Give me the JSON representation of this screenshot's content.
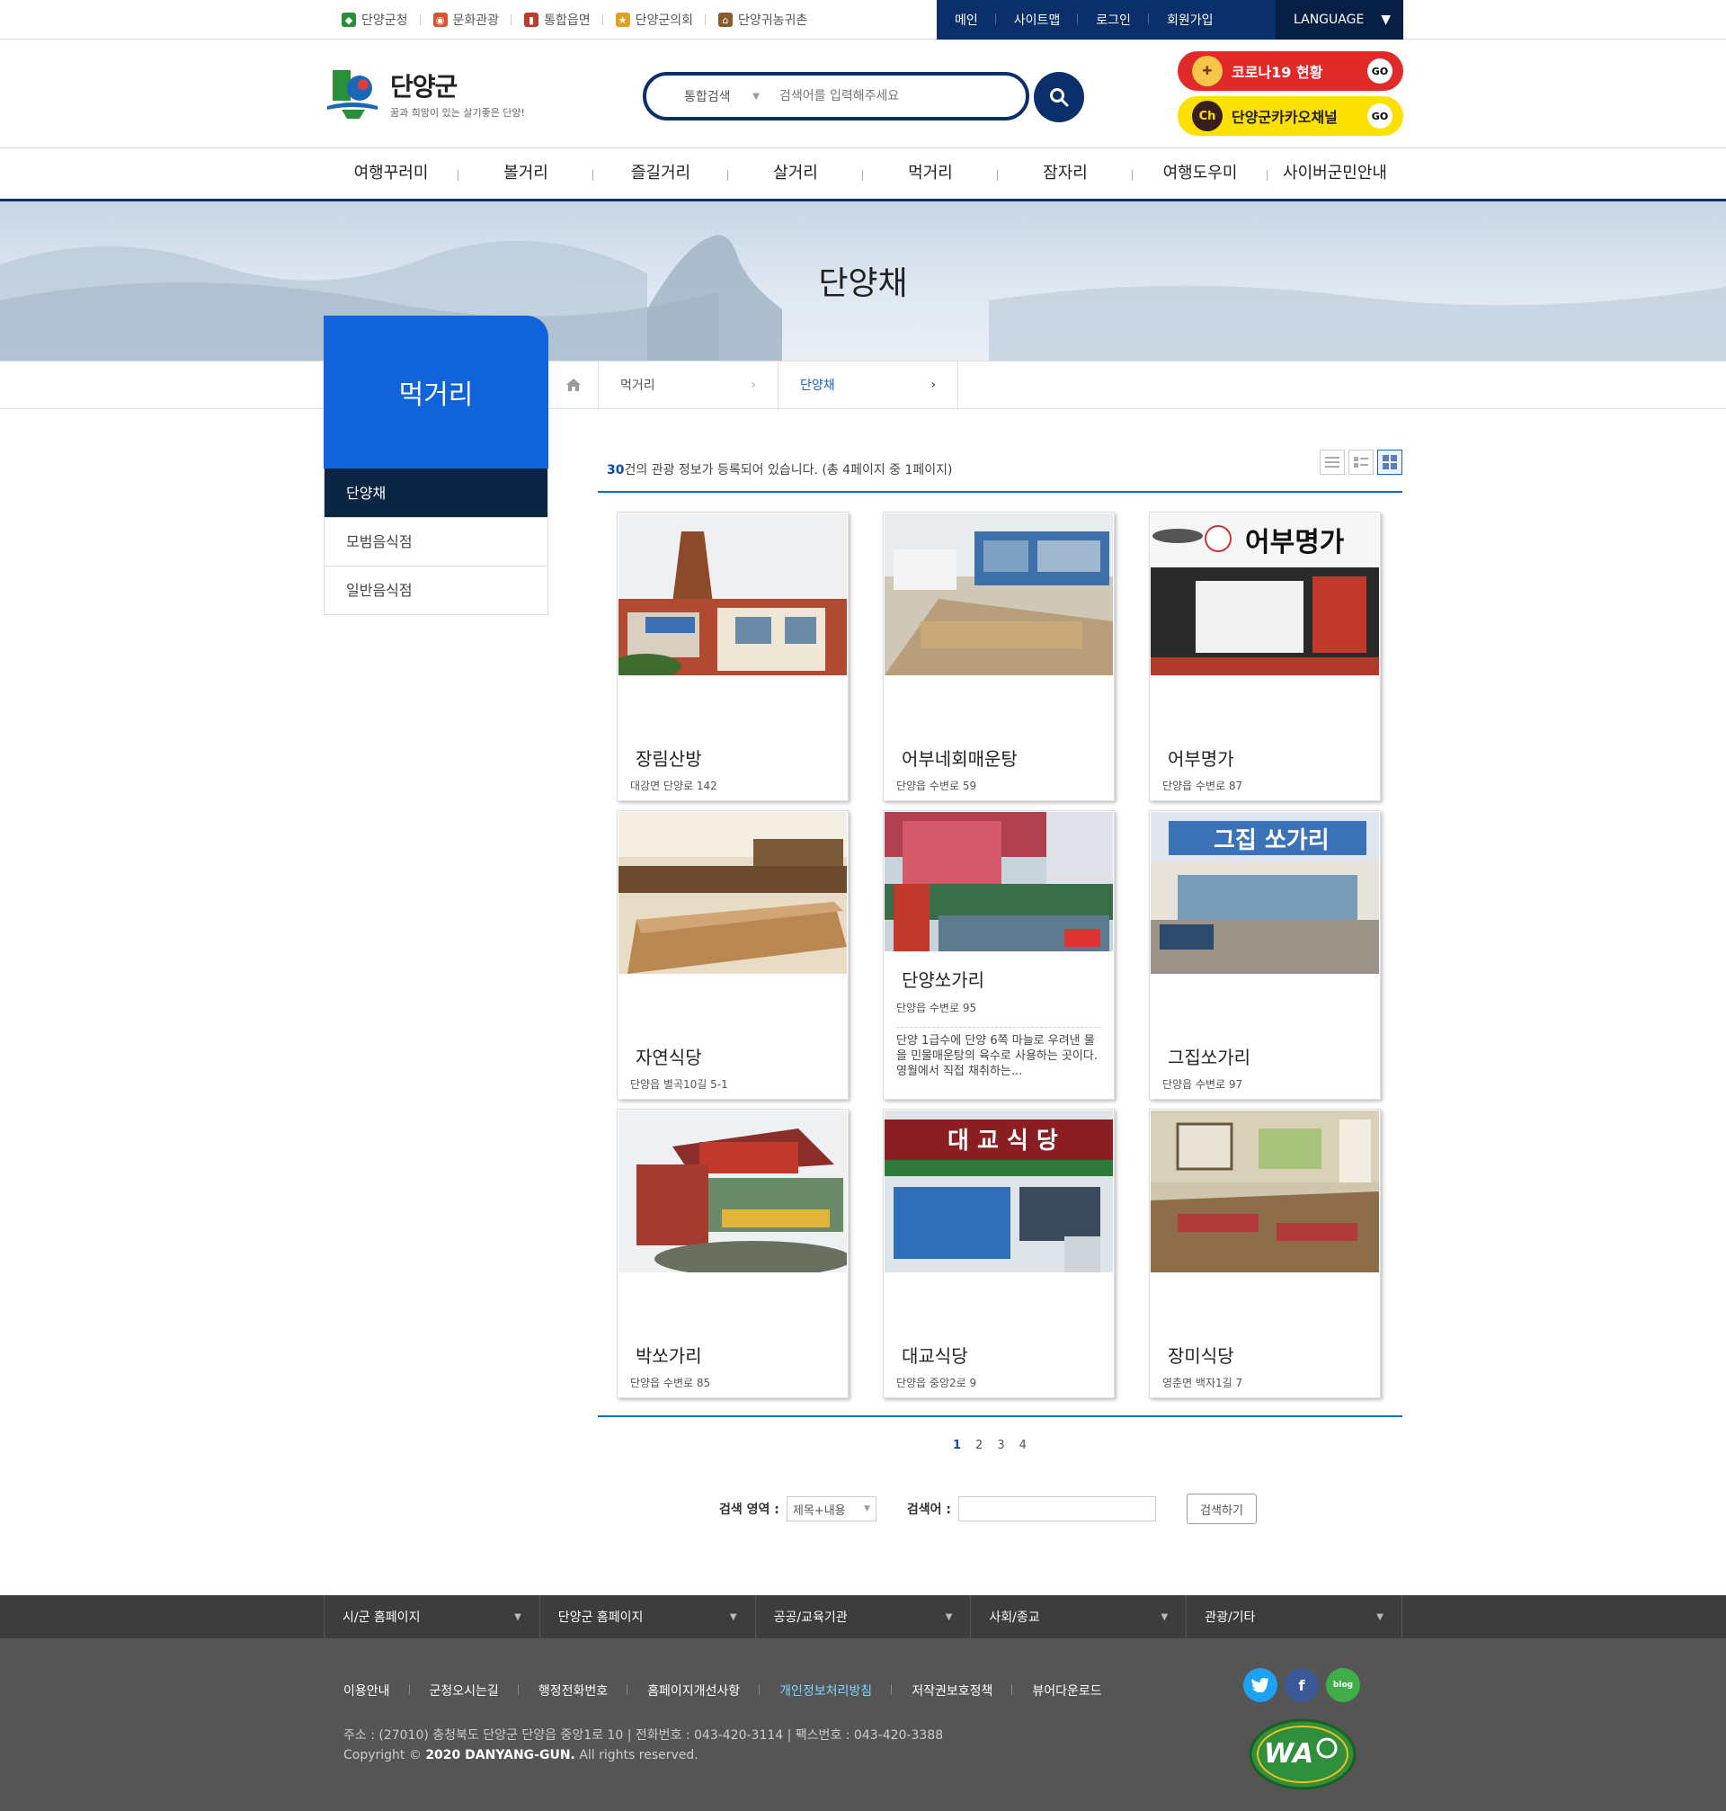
{
  "top_links": [
    {
      "label": "단양군청",
      "icon": "gov-logo-icon",
      "color": "#2a8f3c"
    },
    {
      "label": "문화관광",
      "icon": "camera-icon",
      "color": "#d9532c"
    },
    {
      "label": "통합읍면",
      "icon": "signpost-icon",
      "color": "#c0392b"
    },
    {
      "label": "단양군의회",
      "icon": "council-badge-icon",
      "color": "#e0a020"
    },
    {
      "label": "단양귀농귀촌",
      "icon": "house-icon",
      "color": "#8a5a2b"
    }
  ],
  "user_menu": [
    "메인",
    "사이트맵",
    "로그인",
    "회원가입"
  ],
  "language_label": "LANGUAGE",
  "logo": {
    "title": "단양군",
    "slogan": "꿈과 희망이 있는 살기좋은 단양!"
  },
  "search": {
    "scope": "통합검색",
    "placeholder": "검색어를 입력해주세요"
  },
  "promos": {
    "covid": "코로나19 현황",
    "kakao": "단양군카카오채널",
    "go": "GO",
    "kakao_badge": "Ch"
  },
  "gnb": [
    "여행꾸러미",
    "볼거리",
    "즐길거리",
    "살거리",
    "먹거리",
    "잠자리",
    "여행도우미",
    "사이버군민안내"
  ],
  "page_title": "단양채",
  "lnb": {
    "title": "먹거리",
    "items": [
      "단양채",
      "모범음식점",
      "일반음식점"
    ],
    "active_index": 0
  },
  "breadcrumb": [
    "먹거리",
    "단양채"
  ],
  "summary": {
    "count": "30",
    "text": "건의 관광 정보가 등록되어 있습니다. (총 4페이지 중 1페이지)"
  },
  "cards": [
    {
      "name": "장림산방",
      "addr": "대강면 단양로 142"
    },
    {
      "name": "어부네회매운탕",
      "addr": "단양읍 수변로 59"
    },
    {
      "name": "어부명가",
      "addr": "단양읍 수변로 87"
    },
    {
      "name": "자연식당",
      "addr": "단양읍 별곡10길 5-1"
    },
    {
      "name": "단양쏘가리",
      "addr": "단양읍 수변로 95",
      "desc": "단양 1급수에 단양 6쪽 마늘로 우려낸 물을 민물매운탕의 육수로 사용하는 곳이다. 영월에서 직접 채취하는..."
    },
    {
      "name": "그집쏘가리",
      "addr": "단양읍 수변로 97"
    },
    {
      "name": "박쏘가리",
      "addr": "단양읍 수변로 85"
    },
    {
      "name": "대교식당",
      "addr": "단양읍 중앙2로 9"
    },
    {
      "name": "장미식당",
      "addr": "영춘면 백자1길 7"
    }
  ],
  "pages": [
    "1",
    "2",
    "3",
    "4"
  ],
  "bottom_search": {
    "area_label": "검색 영역 :",
    "area_value": "제목+내용",
    "keyword_label": "검색어 :",
    "button": "검색하기"
  },
  "footer_sites": [
    "시/군 홈페이지",
    "단양군 홈페이지",
    "공공/교육기관",
    "사회/종교",
    "관광/기타"
  ],
  "footer_links": [
    "이용안내",
    "군청오시는길",
    "행정전화번호",
    "홈페이지개선사항",
    "개인정보처리방침",
    "저작권보호정책",
    "뷰어다운로드"
  ],
  "footer_address": "주소 : (27010) 충청북도 단양군 단양읍 중앙1로 10 | 전화번호 : 043-420-3114 | 팩스번호 : 043-420-3388",
  "copyright": {
    "prefix": "Copyright ©",
    "owner": "2020 DANYANG-GUN.",
    "suffix": "All rights reserved."
  },
  "social": {
    "blog": "blog"
  },
  "wa_mark": "WA",
  "colors": {
    "navy": "#0a2f6b",
    "blue": "#1063d9",
    "covid_red": "#e02a2a",
    "kakao_yellow": "#fbe000",
    "footer_gray": "#555555"
  }
}
